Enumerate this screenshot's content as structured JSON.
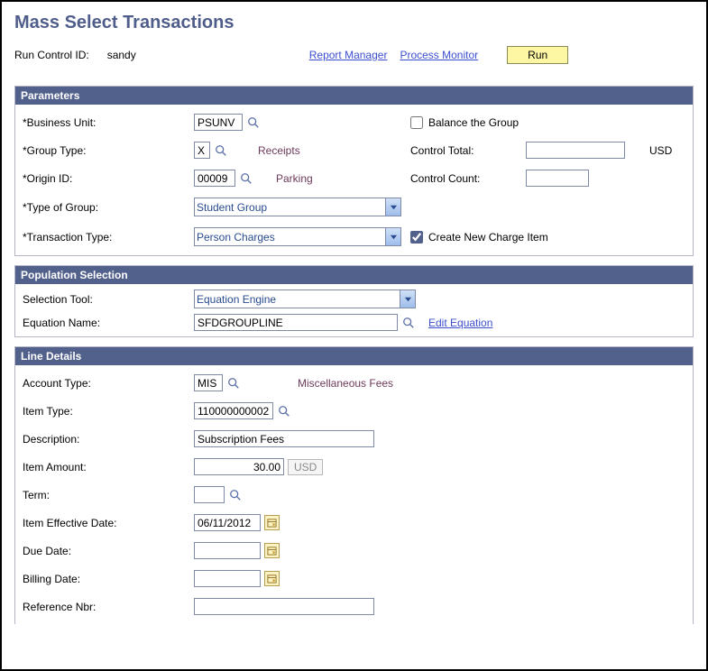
{
  "page_title": "Mass Select Transactions",
  "run_control": {
    "label": "Run Control ID:",
    "value": "sandy"
  },
  "top_links": {
    "report_manager": "Report Manager",
    "process_monitor": "Process Monitor",
    "run": "Run"
  },
  "parameters": {
    "header": "Parameters",
    "business_unit": {
      "label": "Business Unit:",
      "value": "PSUNV"
    },
    "group_type": {
      "label": "Group Type:",
      "value": "X",
      "desc": "Receipts"
    },
    "origin_id": {
      "label": "Origin ID:",
      "value": "00009",
      "desc": "Parking"
    },
    "type_of_group": {
      "label": "Type of Group:",
      "value": "Student Group"
    },
    "transaction_type": {
      "label": "Transaction Type:",
      "value": "Person Charges"
    },
    "balance_group": {
      "label": "Balance the Group",
      "checked": false
    },
    "control_total": {
      "label": "Control Total:",
      "value": "",
      "currency": "USD"
    },
    "control_count": {
      "label": "Control Count:",
      "value": ""
    },
    "create_new_charge": {
      "label": "Create New Charge Item",
      "checked": true
    }
  },
  "population": {
    "header": "Population Selection",
    "selection_tool": {
      "label": "Selection Tool:",
      "value": "Equation Engine"
    },
    "equation_name": {
      "label": "Equation Name:",
      "value": "SFDGROUPLINE"
    },
    "edit_link": "Edit Equation"
  },
  "line_details": {
    "header": "Line Details",
    "account_type": {
      "label": "Account Type:",
      "value": "MIS",
      "desc": "Miscellaneous Fees"
    },
    "item_type": {
      "label": "Item Type:",
      "value": "110000000002"
    },
    "description": {
      "label": "Description:",
      "value": "Subscription Fees"
    },
    "item_amount": {
      "label": "Item Amount:",
      "value": "30.00",
      "currency": "USD"
    },
    "term": {
      "label": "Term:",
      "value": ""
    },
    "item_eff_date": {
      "label": "Item Effective Date:",
      "value": "06/11/2012"
    },
    "due_date": {
      "label": "Due Date:",
      "value": ""
    },
    "billing_date": {
      "label": "Billing Date:",
      "value": ""
    },
    "reference_nbr": {
      "label": "Reference Nbr:",
      "value": ""
    }
  }
}
